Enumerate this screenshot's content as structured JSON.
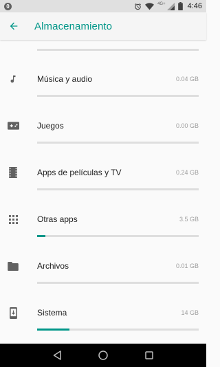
{
  "status_bar": {
    "app_badge": "0",
    "network_label": "4G+",
    "time": "4:46"
  },
  "app_bar": {
    "title": "Almacenamiento"
  },
  "categories": [
    {
      "id": "music",
      "label": "Música y audio",
      "size": "0.04 GB",
      "fill_fraction": 0.0,
      "icon": "music-note-icon"
    },
    {
      "id": "games",
      "label": "Juegos",
      "size": "0.00 GB",
      "fill_fraction": 0.0,
      "icon": "gamepad-icon"
    },
    {
      "id": "movies",
      "label": "Apps de películas y TV",
      "size": "0.24 GB",
      "fill_fraction": 0.0,
      "icon": "film-icon"
    },
    {
      "id": "other_apps",
      "label": "Otras apps",
      "size": "3.5 GB",
      "fill_fraction": 0.05,
      "icon": "apps-grid-icon"
    },
    {
      "id": "files",
      "label": "Archivos",
      "size": "0.01 GB",
      "fill_fraction": 0.0,
      "icon": "folder-icon"
    },
    {
      "id": "system",
      "label": "Sistema",
      "size": "14 GB",
      "fill_fraction": 0.2,
      "icon": "system-phone-icon"
    }
  ],
  "colors": {
    "accent": "#009688",
    "track": "#dedede",
    "icon": "#616161"
  }
}
